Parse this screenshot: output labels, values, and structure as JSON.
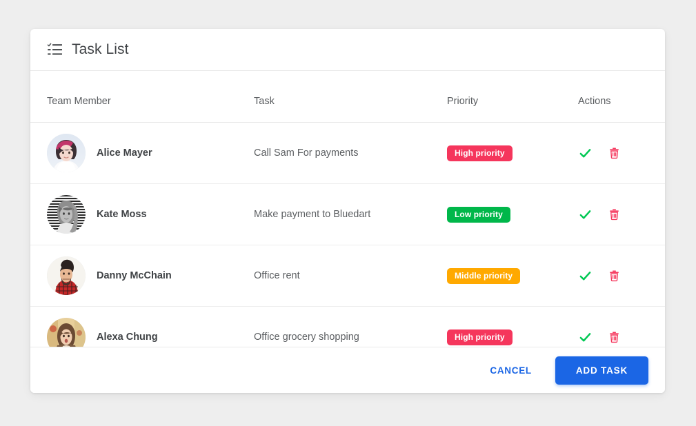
{
  "page": {
    "background_color": "#eeeeee"
  },
  "card": {
    "header": {
      "icon": "checklist-icon",
      "title": "Task List"
    },
    "table": {
      "columns": [
        {
          "key": "member",
          "label": "Team Member"
        },
        {
          "key": "task",
          "label": "Task"
        },
        {
          "key": "priority",
          "label": "Priority"
        },
        {
          "key": "actions",
          "label": "Actions"
        }
      ],
      "rows": [
        {
          "member": "Alice Mayer",
          "avatar": "avatar-alice",
          "task": "Call Sam For payments",
          "priority": {
            "label": "High priority",
            "color": "#f5365c"
          },
          "actions": [
            {
              "name": "complete-task-button",
              "icon": "check-icon",
              "color": "#00c853"
            },
            {
              "name": "delete-task-button",
              "icon": "trash-icon",
              "color": "#f5365c"
            }
          ]
        },
        {
          "member": "Kate Moss",
          "avatar": "avatar-kate",
          "task": "Make payment to Bluedart",
          "priority": {
            "label": "Low priority",
            "color": "#00b74a"
          },
          "actions": [
            {
              "name": "complete-task-button",
              "icon": "check-icon",
              "color": "#00c853"
            },
            {
              "name": "delete-task-button",
              "icon": "trash-icon",
              "color": "#f5365c"
            }
          ]
        },
        {
          "member": "Danny McChain",
          "avatar": "avatar-danny",
          "task": "Office rent",
          "priority": {
            "label": "Middle priority",
            "color": "#ffa900"
          },
          "actions": [
            {
              "name": "complete-task-button",
              "icon": "check-icon",
              "color": "#00c853"
            },
            {
              "name": "delete-task-button",
              "icon": "trash-icon",
              "color": "#f5365c"
            }
          ]
        },
        {
          "member": "Alexa Chung",
          "avatar": "avatar-alexa",
          "task": "Office grocery shopping",
          "priority": {
            "label": "High priority",
            "color": "#f5365c"
          },
          "actions": [
            {
              "name": "complete-task-button",
              "icon": "check-icon",
              "color": "#00c853"
            },
            {
              "name": "delete-task-button",
              "icon": "trash-icon",
              "color": "#f5365c"
            }
          ]
        }
      ]
    },
    "footer": {
      "cancel_label": "CANCEL",
      "add_label": "ADD TASK",
      "accent_color": "#1b66e5"
    }
  }
}
